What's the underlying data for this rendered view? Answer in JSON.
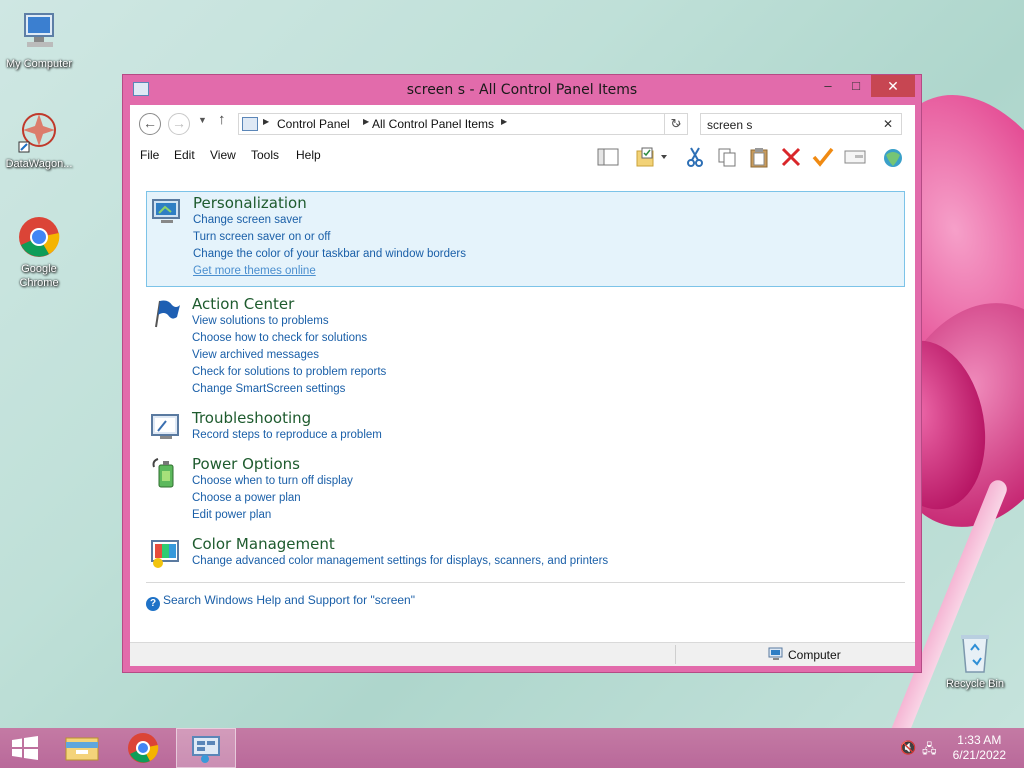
{
  "desktop": {
    "icons": [
      {
        "label": "My Computer"
      },
      {
        "label": "DataWagon..."
      },
      {
        "label": "Google Chrome"
      },
      {
        "label": "Recycle Bin"
      }
    ]
  },
  "window": {
    "title": "screen s - All Control Panel Items",
    "buttons": {
      "minimize": "–",
      "maximize": "□",
      "close": "✕"
    }
  },
  "navigation": {
    "back": "←",
    "forward": "→",
    "up": "↑",
    "breadcrumbs": [
      "Control Panel",
      "All Control Panel Items"
    ],
    "refresh": "↻",
    "search_value": "screen s",
    "search_clear": "✕"
  },
  "menu": [
    "File",
    "Edit",
    "View",
    "Tools",
    "Help"
  ],
  "toolbar_icons": [
    "layout-icon",
    "folder-properties-icon",
    "cut-icon",
    "copy-icon",
    "paste-icon",
    "delete-icon",
    "checkmark-icon",
    "window-icon",
    "globe-icon"
  ],
  "groups": [
    {
      "title": "Personalization",
      "icon": "personalization-icon",
      "links": [
        "Change screen saver",
        "Turn screen saver on or off",
        "Change the color of your taskbar and window borders",
        "Get more themes online"
      ]
    },
    {
      "title": "Action Center",
      "icon": "action-center-flag-icon",
      "links": [
        "View solutions to problems",
        "Choose how to check for solutions",
        "View archived messages",
        "Check for solutions to problem reports",
        "Change SmartScreen settings"
      ]
    },
    {
      "title": "Troubleshooting",
      "icon": "troubleshooting-icon",
      "links": [
        "Record steps to reproduce a problem"
      ]
    },
    {
      "title": "Power Options",
      "icon": "power-options-icon",
      "links": [
        "Choose when to turn off display",
        "Choose a power plan",
        "Edit power plan"
      ]
    },
    {
      "title": "Color Management",
      "icon": "color-management-icon",
      "links": [
        "Change advanced color management settings for displays, scanners, and printers"
      ]
    }
  ],
  "help_link": "Search Windows Help and Support for \"screen\"",
  "statusbar": {
    "location": "Computer"
  },
  "taskbar": {
    "apps": [
      "start",
      "file-explorer",
      "chrome",
      "control-panel"
    ],
    "time": "1:33 AM",
    "date": "6/21/2022"
  }
}
